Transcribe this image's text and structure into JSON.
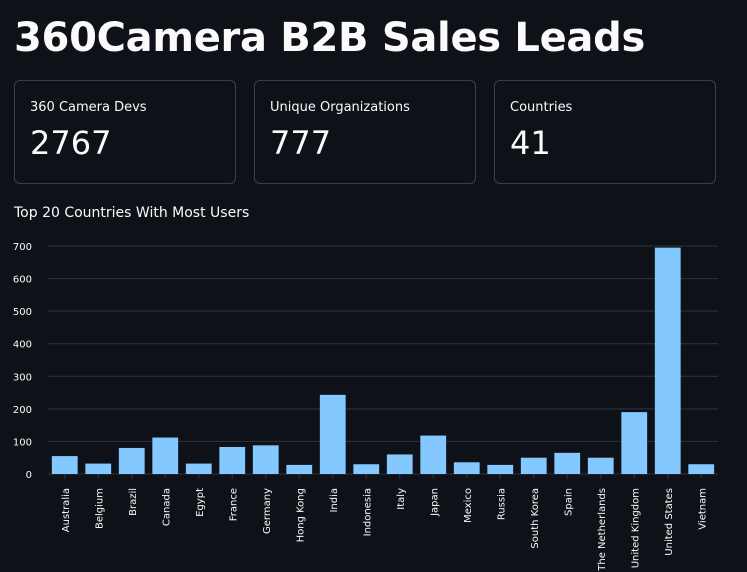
{
  "page": {
    "title": "360Camera B2B Sales Leads"
  },
  "metrics": [
    {
      "label": "360 Camera Devs",
      "value": "2767"
    },
    {
      "label": "Unique Organizations",
      "value": "777"
    },
    {
      "label": "Countries",
      "value": "41"
    }
  ],
  "colors": {
    "bar": "#83c9ff",
    "background": "#0e1117",
    "grid": "#31333f"
  },
  "chart_data": {
    "type": "bar",
    "title": "Top 20 Countries With Most Users",
    "xlabel": "",
    "ylabel": "",
    "ylim": [
      0,
      700
    ],
    "yticks": [
      0,
      100,
      200,
      300,
      400,
      500,
      600,
      700
    ],
    "grid": true,
    "categories": [
      "Australia",
      "Belgium",
      "Brazil",
      "Canada",
      "Egypt",
      "France",
      "Germany",
      "Hong Kong",
      "India",
      "Indonesia",
      "Italy",
      "Japan",
      "Mexico",
      "Russia",
      "South Korea",
      "Spain",
      "The Netherlands",
      "United Kingdom",
      "United States",
      "Vietnam"
    ],
    "values": [
      55,
      32,
      80,
      112,
      32,
      83,
      88,
      28,
      243,
      30,
      60,
      118,
      36,
      28,
      50,
      65,
      50,
      190,
      695,
      30
    ]
  }
}
